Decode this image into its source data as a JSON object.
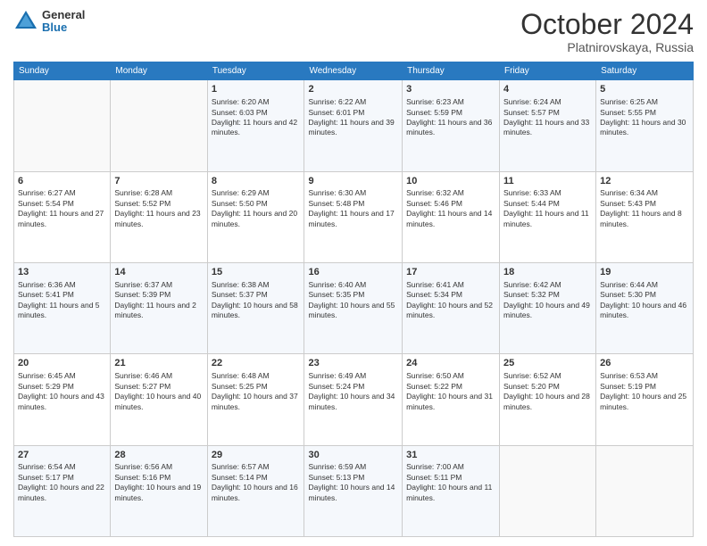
{
  "header": {
    "logo_general": "General",
    "logo_blue": "Blue",
    "month_title": "October 2024",
    "location": "Platnirovskaya, Russia"
  },
  "days_of_week": [
    "Sunday",
    "Monday",
    "Tuesday",
    "Wednesday",
    "Thursday",
    "Friday",
    "Saturday"
  ],
  "weeks": [
    [
      {
        "day": "",
        "info": ""
      },
      {
        "day": "",
        "info": ""
      },
      {
        "day": "1",
        "info": "Sunrise: 6:20 AM\nSunset: 6:03 PM\nDaylight: 11 hours and 42 minutes."
      },
      {
        "day": "2",
        "info": "Sunrise: 6:22 AM\nSunset: 6:01 PM\nDaylight: 11 hours and 39 minutes."
      },
      {
        "day": "3",
        "info": "Sunrise: 6:23 AM\nSunset: 5:59 PM\nDaylight: 11 hours and 36 minutes."
      },
      {
        "day": "4",
        "info": "Sunrise: 6:24 AM\nSunset: 5:57 PM\nDaylight: 11 hours and 33 minutes."
      },
      {
        "day": "5",
        "info": "Sunrise: 6:25 AM\nSunset: 5:55 PM\nDaylight: 11 hours and 30 minutes."
      }
    ],
    [
      {
        "day": "6",
        "info": "Sunrise: 6:27 AM\nSunset: 5:54 PM\nDaylight: 11 hours and 27 minutes."
      },
      {
        "day": "7",
        "info": "Sunrise: 6:28 AM\nSunset: 5:52 PM\nDaylight: 11 hours and 23 minutes."
      },
      {
        "day": "8",
        "info": "Sunrise: 6:29 AM\nSunset: 5:50 PM\nDaylight: 11 hours and 20 minutes."
      },
      {
        "day": "9",
        "info": "Sunrise: 6:30 AM\nSunset: 5:48 PM\nDaylight: 11 hours and 17 minutes."
      },
      {
        "day": "10",
        "info": "Sunrise: 6:32 AM\nSunset: 5:46 PM\nDaylight: 11 hours and 14 minutes."
      },
      {
        "day": "11",
        "info": "Sunrise: 6:33 AM\nSunset: 5:44 PM\nDaylight: 11 hours and 11 minutes."
      },
      {
        "day": "12",
        "info": "Sunrise: 6:34 AM\nSunset: 5:43 PM\nDaylight: 11 hours and 8 minutes."
      }
    ],
    [
      {
        "day": "13",
        "info": "Sunrise: 6:36 AM\nSunset: 5:41 PM\nDaylight: 11 hours and 5 minutes."
      },
      {
        "day": "14",
        "info": "Sunrise: 6:37 AM\nSunset: 5:39 PM\nDaylight: 11 hours and 2 minutes."
      },
      {
        "day": "15",
        "info": "Sunrise: 6:38 AM\nSunset: 5:37 PM\nDaylight: 10 hours and 58 minutes."
      },
      {
        "day": "16",
        "info": "Sunrise: 6:40 AM\nSunset: 5:35 PM\nDaylight: 10 hours and 55 minutes."
      },
      {
        "day": "17",
        "info": "Sunrise: 6:41 AM\nSunset: 5:34 PM\nDaylight: 10 hours and 52 minutes."
      },
      {
        "day": "18",
        "info": "Sunrise: 6:42 AM\nSunset: 5:32 PM\nDaylight: 10 hours and 49 minutes."
      },
      {
        "day": "19",
        "info": "Sunrise: 6:44 AM\nSunset: 5:30 PM\nDaylight: 10 hours and 46 minutes."
      }
    ],
    [
      {
        "day": "20",
        "info": "Sunrise: 6:45 AM\nSunset: 5:29 PM\nDaylight: 10 hours and 43 minutes."
      },
      {
        "day": "21",
        "info": "Sunrise: 6:46 AM\nSunset: 5:27 PM\nDaylight: 10 hours and 40 minutes."
      },
      {
        "day": "22",
        "info": "Sunrise: 6:48 AM\nSunset: 5:25 PM\nDaylight: 10 hours and 37 minutes."
      },
      {
        "day": "23",
        "info": "Sunrise: 6:49 AM\nSunset: 5:24 PM\nDaylight: 10 hours and 34 minutes."
      },
      {
        "day": "24",
        "info": "Sunrise: 6:50 AM\nSunset: 5:22 PM\nDaylight: 10 hours and 31 minutes."
      },
      {
        "day": "25",
        "info": "Sunrise: 6:52 AM\nSunset: 5:20 PM\nDaylight: 10 hours and 28 minutes."
      },
      {
        "day": "26",
        "info": "Sunrise: 6:53 AM\nSunset: 5:19 PM\nDaylight: 10 hours and 25 minutes."
      }
    ],
    [
      {
        "day": "27",
        "info": "Sunrise: 6:54 AM\nSunset: 5:17 PM\nDaylight: 10 hours and 22 minutes."
      },
      {
        "day": "28",
        "info": "Sunrise: 6:56 AM\nSunset: 5:16 PM\nDaylight: 10 hours and 19 minutes."
      },
      {
        "day": "29",
        "info": "Sunrise: 6:57 AM\nSunset: 5:14 PM\nDaylight: 10 hours and 16 minutes."
      },
      {
        "day": "30",
        "info": "Sunrise: 6:59 AM\nSunset: 5:13 PM\nDaylight: 10 hours and 14 minutes."
      },
      {
        "day": "31",
        "info": "Sunrise: 7:00 AM\nSunset: 5:11 PM\nDaylight: 10 hours and 11 minutes."
      },
      {
        "day": "",
        "info": ""
      },
      {
        "day": "",
        "info": ""
      }
    ]
  ]
}
